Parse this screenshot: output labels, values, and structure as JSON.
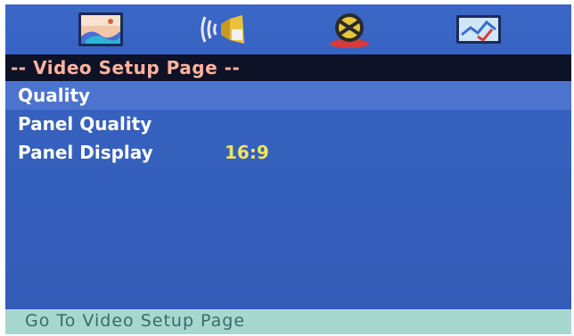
{
  "tabs": [
    {
      "icon": "video-setup-icon"
    },
    {
      "icon": "audio-setup-icon"
    },
    {
      "icon": "misc-setup-icon"
    },
    {
      "icon": "preference-setup-icon"
    }
  ],
  "header": {
    "title": "-- Video Setup Page --"
  },
  "menu": {
    "items": [
      {
        "label": "Quality",
        "value": ""
      },
      {
        "label": "Panel Quality",
        "value": ""
      },
      {
        "label": "Panel Display",
        "value": "16:9"
      }
    ]
  },
  "status": {
    "text": "Go To Video Setup Page"
  },
  "colors": {
    "screen": "#3560bd",
    "header_bg": "#0d1226",
    "header_text": "#ffb3a0",
    "value_text": "#f2e45c",
    "status_bg": "#a6d8cf",
    "status_text": "#3a6b68"
  }
}
